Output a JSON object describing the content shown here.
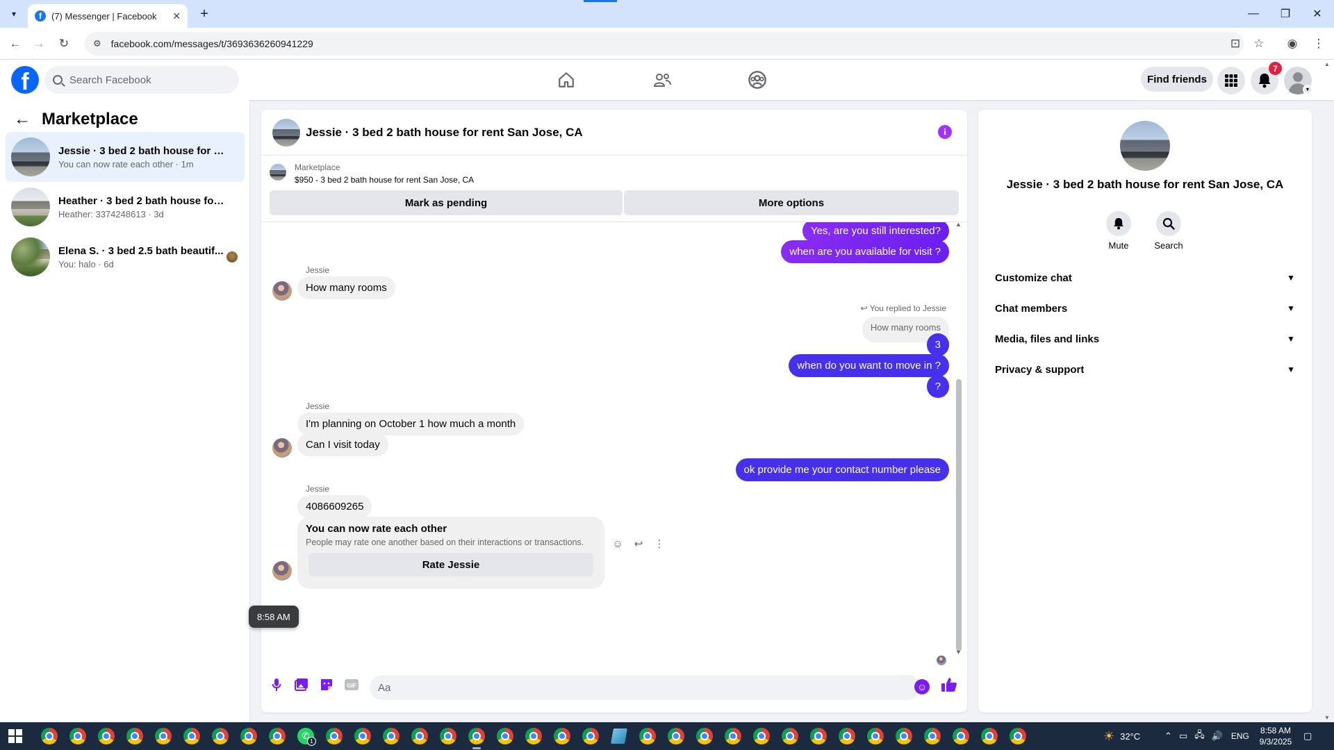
{
  "browser": {
    "tab_title": "(7) Messenger | Facebook",
    "url": "facebook.com/messages/t/3693636260941229"
  },
  "fb_header": {
    "search_placeholder": "Search Facebook",
    "find_friends": "Find friends",
    "notification_count": "7"
  },
  "sidebar": {
    "title": "Marketplace",
    "conversations": [
      {
        "name": "Jessie · 3 bed 2 bath house for ren...",
        "sub": "You can now rate each other · 1m"
      },
      {
        "name": "Heather · 3 bed 2 bath house for r...",
        "sub": "Heather: 3374248613 · 3d"
      },
      {
        "name": "Elena S. · 3 bed 2.5 bath beautif...",
        "sub": "You: halo · 6d"
      }
    ]
  },
  "chat": {
    "title": "Jessie · 3 bed 2 bath house for rent San Jose, CA",
    "marketplace_label": "Marketplace",
    "listing": "$950 - 3 bed 2 bath house for rent San Jose, CA",
    "mark_pending": "Mark as pending",
    "more_options": "More options",
    "messages": {
      "out1": "Yes, are you still interested?",
      "out2": "when are you available for visit ?",
      "sender": "Jessie",
      "in1": "How many rooms",
      "reply_label": "You replied to Jessie",
      "reply_quote": "How many rooms",
      "out3": "3",
      "out4": "when do you want to move in ?",
      "out5": "?",
      "in2": "I'm planning on October 1 how much a month",
      "in3": "Can I visit today",
      "out6": "ok provide me your contact number please",
      "in4": "4086609265",
      "rate_title": "You can now rate each other",
      "rate_desc": "People may rate one another based on their interactions or transactions.",
      "rate_button": "Rate Jessie",
      "timestamp": "8:58 AM"
    },
    "composer_placeholder": "Aa"
  },
  "right_panel": {
    "title": "Jessie · 3 bed 2 bath house for rent San Jose, CA",
    "mute": "Mute",
    "search": "Search",
    "sections": [
      "Customize chat",
      "Chat members",
      "Media, files and links",
      "Privacy & support"
    ]
  },
  "taskbar": {
    "weather": "32°C",
    "lang": "ENG",
    "time": "8:58 AM",
    "date": "9/3/2025",
    "whatsapp_badge": "1"
  },
  "colors": {
    "fb_blue": "#0866ff",
    "messenger_purple": "#7b1cf5",
    "badge_red": "#e41e3f"
  }
}
